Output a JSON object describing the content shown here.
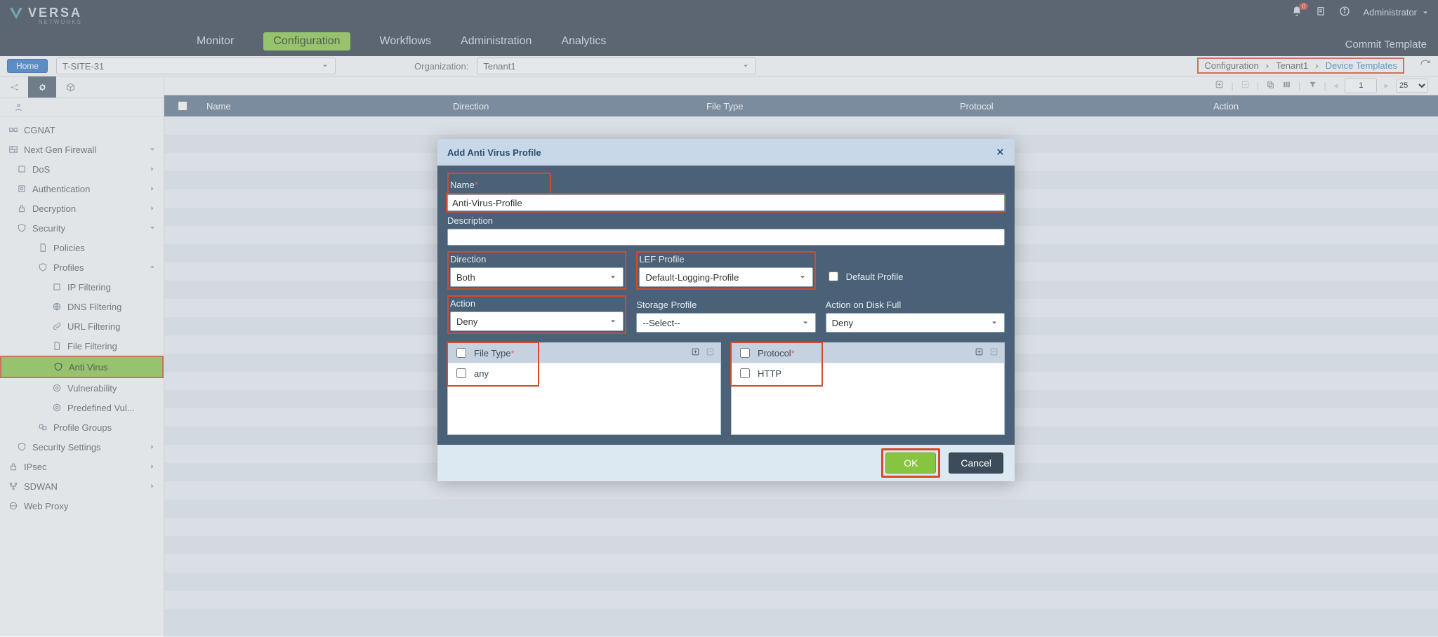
{
  "brand": {
    "name": "VERSA",
    "sub": "NETWORKS"
  },
  "top_icons": {
    "bell_count": "0"
  },
  "user": {
    "label": "Administrator"
  },
  "nav": {
    "monitor": "Monitor",
    "configuration": "Configuration",
    "workflows": "Workflows",
    "administration": "Administration",
    "analytics": "Analytics"
  },
  "commit": "Commit Template",
  "subbar": {
    "home": "Home",
    "site": "T-SITE-31",
    "org_label": "Organization:",
    "org_value": "Tenant1"
  },
  "breadcrumb": {
    "a": "Configuration",
    "b": "Tenant1",
    "c": "Device Templates"
  },
  "tree": {
    "cgnat": "CGNAT",
    "ngfw": "Next Gen Firewall",
    "dos": "DoS",
    "auth": "Authentication",
    "decrypt": "Decryption",
    "security": "Security",
    "policies": "Policies",
    "profiles": "Profiles",
    "ipfilter": "IP Filtering",
    "dnsfilter": "DNS Filtering",
    "urlfilter": "URL Filtering",
    "filefilter": "File Filtering",
    "antivirus": "Anti Virus",
    "vuln": "Vulnerability",
    "predef": "Predefined Vul...",
    "profgroups": "Profile Groups",
    "secset": "Security Settings",
    "ipsec": "IPsec",
    "sdwan": "SDWAN",
    "webproxy": "Web Proxy"
  },
  "grid": {
    "cols": {
      "name": "Name",
      "direction": "Direction",
      "filetype": "File Type",
      "protocol": "Protocol",
      "action": "Action"
    }
  },
  "toolbar": {
    "page": "1",
    "pagesize": "25"
  },
  "modal": {
    "title": "Add Anti Virus Profile",
    "name_label": "Name",
    "name_value": "Anti-Virus-Profile",
    "desc_label": "Description",
    "desc_value": "",
    "direction_label": "Direction",
    "direction_value": "Both",
    "lef_label": "LEF Profile",
    "lef_value": "Default-Logging-Profile",
    "default_profile": "Default Profile",
    "action_label": "Action",
    "action_value": "Deny",
    "storage_label": "Storage Profile",
    "storage_value": "--Select--",
    "diskfull_label": "Action on Disk Full",
    "diskfull_value": "Deny",
    "filetype_head": "File Type",
    "filetype_row": "any",
    "protocol_head": "Protocol",
    "protocol_row": "HTTP",
    "ok": "OK",
    "cancel": "Cancel"
  }
}
